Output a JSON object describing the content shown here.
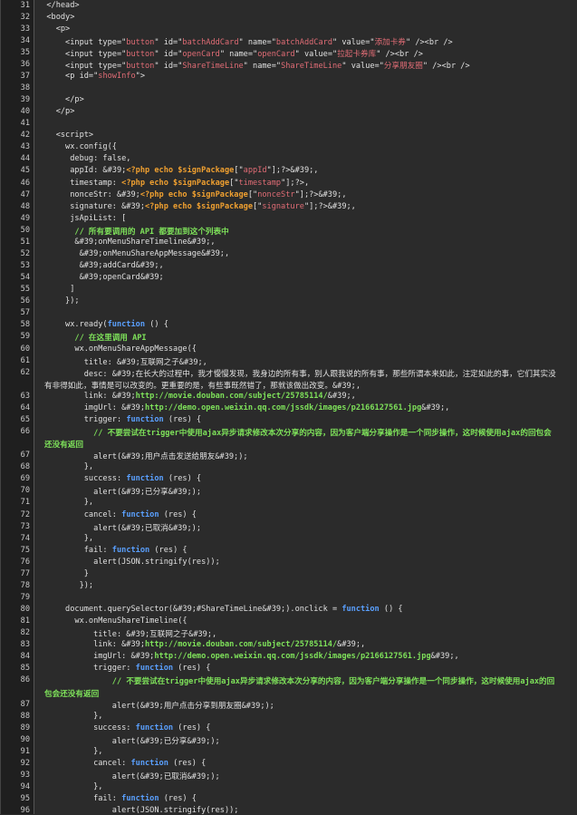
{
  "lines": [
    {
      "n": "31",
      "t": "  </head>"
    },
    {
      "n": "32",
      "t": "  <body>"
    },
    {
      "n": "33",
      "t": "    <p>"
    },
    {
      "n": "34",
      "t": "      <input type=\"button\" id=\"batchAddCard\" name=\"batchAddCard\" value=\"添加卡券\" /><br />"
    },
    {
      "n": "35",
      "t": "      <input type=\"button\" id=\"openCard\" name=\"openCard\" value=\"拉起卡券库\" /><br />"
    },
    {
      "n": "36",
      "t": "      <input type=\"button\" id=\"ShareTimeLine\" name=\"ShareTimeLine\" value=\"分享朋友圈\" /><br />"
    },
    {
      "n": "37",
      "t": "      <p id=\"showInfo\">"
    },
    {
      "n": "38",
      "t": ""
    },
    {
      "n": "39",
      "t": "      </p>"
    },
    {
      "n": "40",
      "t": "    </p>"
    },
    {
      "n": "41",
      "t": ""
    },
    {
      "n": "42",
      "t": "    <script>"
    },
    {
      "n": "43",
      "t": "      wx.config({"
    },
    {
      "n": "44",
      "t": "       debug: false,"
    },
    {
      "n": "45",
      "t": "       appId: &#39;<?php echo $signPackage[\"appId\"];?>&#39;,"
    },
    {
      "n": "46",
      "t": "       timestamp: <?php echo $signPackage[\"timestamp\"];?>,"
    },
    {
      "n": "47",
      "t": "       nonceStr: &#39;<?php echo $signPackage[\"nonceStr\"];?>&#39;,"
    },
    {
      "n": "48",
      "t": "       signature: &#39;<?php echo $signPackage[\"signature\"];?>&#39;,"
    },
    {
      "n": "49",
      "t": "       jsApiList: ["
    },
    {
      "n": "50",
      "t": "        // 所有要调用的 API 都要加到这个列表中"
    },
    {
      "n": "51",
      "t": "        &#39;onMenuShareTimeline&#39;,"
    },
    {
      "n": "52",
      "t": "         &#39;onMenuShareAppMessage&#39;,"
    },
    {
      "n": "53",
      "t": "         &#39;addCard&#39;,"
    },
    {
      "n": "54",
      "t": "         &#39;openCard&#39;"
    },
    {
      "n": "55",
      "t": "       ]"
    },
    {
      "n": "56",
      "t": "      });"
    },
    {
      "n": "57",
      "t": ""
    },
    {
      "n": "58",
      "t": "      wx.ready(function () {"
    },
    {
      "n": "59",
      "t": "        // 在这里调用 API"
    },
    {
      "n": "60",
      "t": "        wx.onMenuShareAppMessage({"
    },
    {
      "n": "61",
      "t": "          title: &#39;互联网之子&#39;,"
    },
    {
      "n": "62",
      "t": "          desc: &#39;在长大的过程中，我才慢慢发现，我身边的所有事，别人跟我说的所有事，那些所谓本来如此，注定如此的事，它们其实没"
    },
    {
      "n": "",
      "t": "有非得如此，事情是可以改变的。更重要的是，有些事既然错了，那就该做出改变。&#39;,"
    },
    {
      "n": "63",
      "t": "          link: &#39;http://movie.douban.com/subject/25785114/&#39;,"
    },
    {
      "n": "64",
      "t": "          imgUrl: &#39;http://demo.open.weixin.qq.com/jssdk/images/p2166127561.jpg&#39;,"
    },
    {
      "n": "65",
      "t": "          trigger: function (res) {"
    },
    {
      "n": "66",
      "t": "            // 不要尝试在trigger中使用ajax异步请求修改本次分享的内容，因为客户端分享操作是一个同步操作，这时候使用ajax的回包会"
    },
    {
      "n": "",
      "t": "还没有返回"
    },
    {
      "n": "67",
      "t": "            alert(&#39;用户点击发送给朋友&#39;);"
    },
    {
      "n": "68",
      "t": "          },"
    },
    {
      "n": "69",
      "t": "          success: function (res) {"
    },
    {
      "n": "70",
      "t": "            alert(&#39;已分享&#39;);"
    },
    {
      "n": "71",
      "t": "          },"
    },
    {
      "n": "72",
      "t": "          cancel: function (res) {"
    },
    {
      "n": "73",
      "t": "            alert(&#39;已取消&#39;);"
    },
    {
      "n": "74",
      "t": "          },"
    },
    {
      "n": "75",
      "t": "          fail: function (res) {"
    },
    {
      "n": "76",
      "t": "            alert(JSON.stringify(res));"
    },
    {
      "n": "77",
      "t": "          }"
    },
    {
      "n": "78",
      "t": "         });"
    },
    {
      "n": "79",
      "t": ""
    },
    {
      "n": "80",
      "t": "      document.querySelector(&#39;#ShareTimeLine&#39;).onclick = function () {"
    },
    {
      "n": "81",
      "t": "        wx.onMenuShareTimeline({"
    },
    {
      "n": "82",
      "t": "            title: &#39;互联网之子&#39;,"
    },
    {
      "n": "83",
      "t": "            link: &#39;http://movie.douban.com/subject/25785114/&#39;,"
    },
    {
      "n": "84",
      "t": "            imgUrl: &#39;http://demo.open.weixin.qq.com/jssdk/images/p2166127561.jpg&#39;,"
    },
    {
      "n": "85",
      "t": "            trigger: function (res) {"
    },
    {
      "n": "86",
      "t": "                // 不要尝试在trigger中使用ajax异步请求修改本次分享的内容，因为客户端分享操作是一个同步操作，这时候使用ajax的回"
    },
    {
      "n": "",
      "t": "包会还没有返回"
    },
    {
      "n": "87",
      "t": "                alert(&#39;用户点击分享到朋友圈&#39;);"
    },
    {
      "n": "88",
      "t": "            },"
    },
    {
      "n": "89",
      "t": "            success: function (res) {"
    },
    {
      "n": "90",
      "t": "                alert(&#39;已分享&#39;);"
    },
    {
      "n": "91",
      "t": "            },"
    },
    {
      "n": "92",
      "t": "            cancel: function (res) {"
    },
    {
      "n": "93",
      "t": "                alert(&#39;已取消&#39;);"
    },
    {
      "n": "94",
      "t": "            },"
    },
    {
      "n": "95",
      "t": "            fail: function (res) {"
    },
    {
      "n": "96",
      "t": "                alert(JSON.stringify(res));"
    }
  ]
}
